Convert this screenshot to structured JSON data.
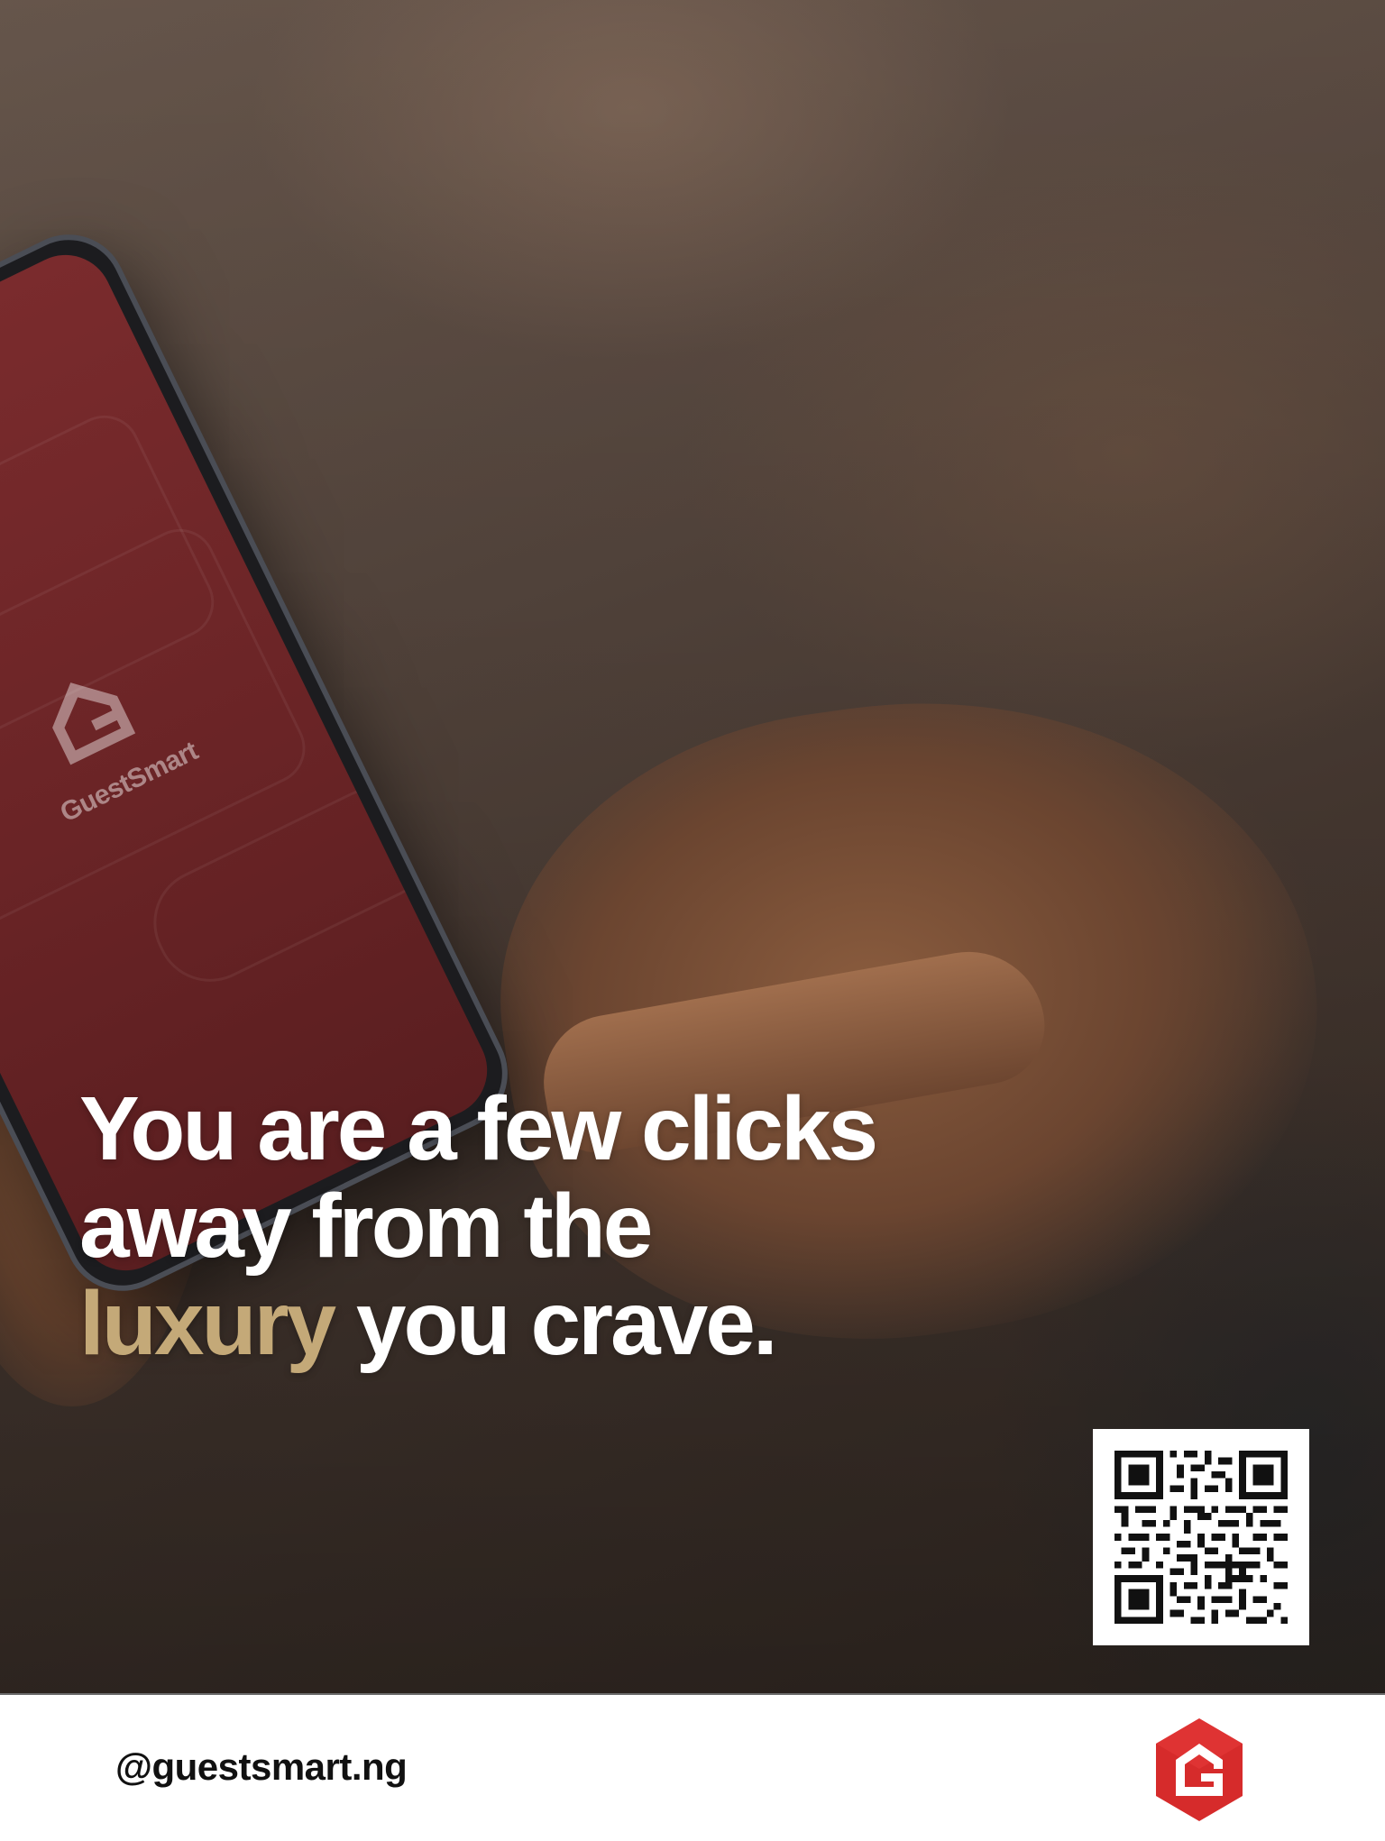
{
  "app": {
    "name": "GuestSmart"
  },
  "headline": {
    "line1": "You are a few clicks",
    "line2": "away from the",
    "accent_word": "luxury",
    "line3_rest": " you crave."
  },
  "footer": {
    "handle": "@guestsmart.ng"
  },
  "colors": {
    "accent": "#c4a978",
    "brand_red": "#d62b2b",
    "phone_screen": "#7a2b2d"
  },
  "icons": {
    "brand_logo": "guestsmart-logo-icon",
    "qr": "qr-code-icon"
  }
}
